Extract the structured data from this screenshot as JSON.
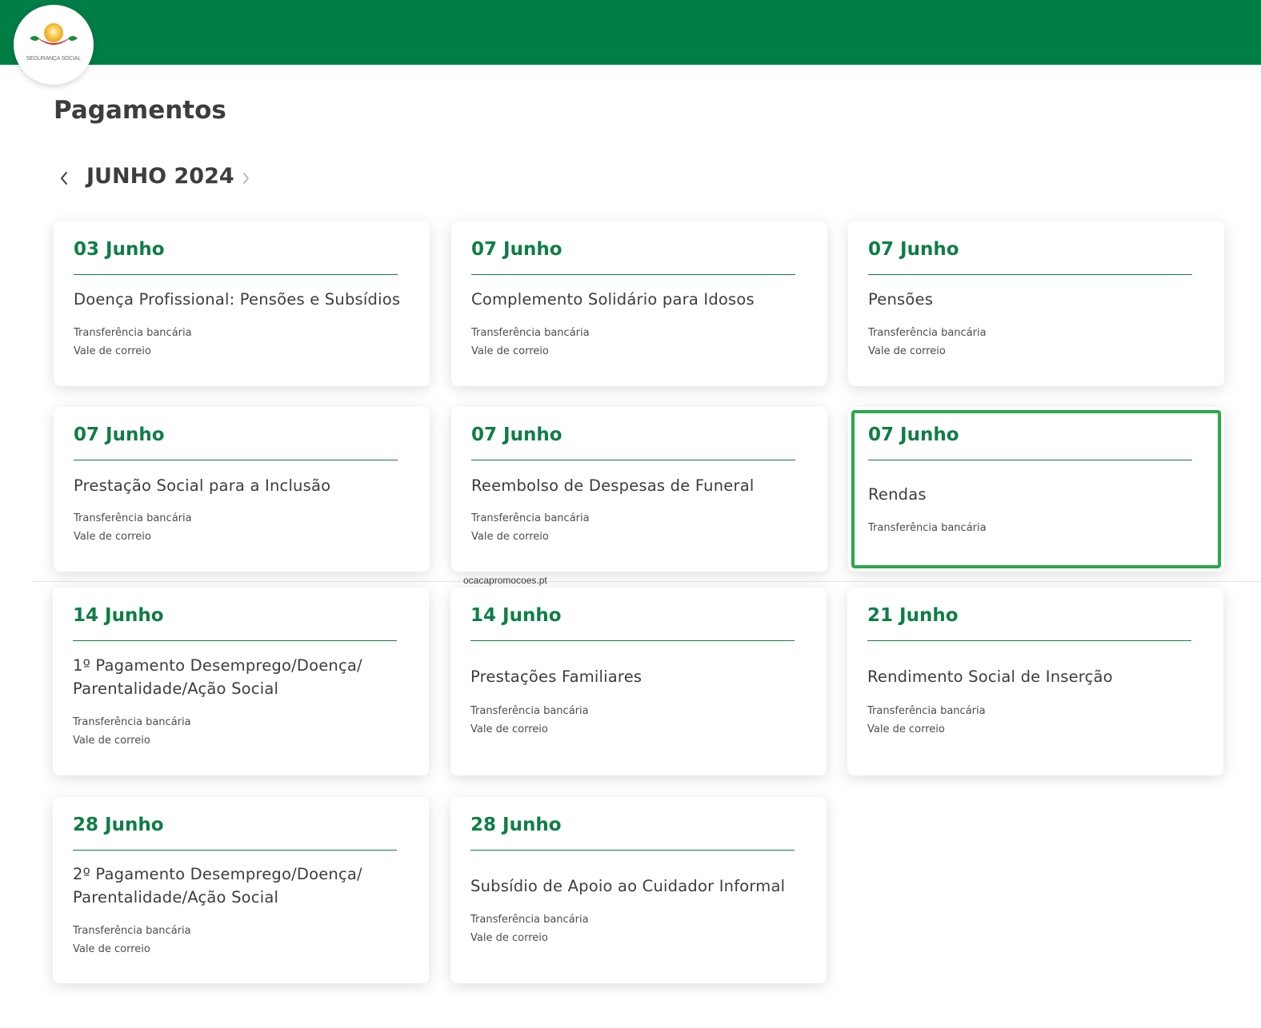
{
  "brand": {
    "name": "SEGURANÇA SOCIAL",
    "colors": {
      "header": "#017e45",
      "accent": "#0e7e46",
      "highlight": "#2aa84a"
    }
  },
  "page": {
    "title": "Pagamentos"
  },
  "month_nav": {
    "label": "JUNHO 2024",
    "prev_icon": "chevron-left-icon",
    "next_icon": "chevron-right-icon"
  },
  "cards": [
    {
      "date": "03 Junho",
      "title": "Doença Profissional: Pensões e Subsídios",
      "methods": [
        "Transferência bancária",
        "Vale de correio"
      ]
    },
    {
      "date": "07 Junho",
      "title": "Complemento Solidário para Idosos",
      "methods": [
        "Transferência bancária",
        "Vale de correio"
      ]
    },
    {
      "date": "07 Junho",
      "title": "Pensões",
      "methods": [
        "Transferência bancária",
        "Vale de correio"
      ]
    },
    {
      "date": "07 Junho",
      "title": "Prestação Social para a Inclusão",
      "methods": [
        "Transferência bancária",
        "Vale de correio"
      ]
    },
    {
      "date": "07 Junho",
      "title": "Reembolso de Despesas de Funeral",
      "methods": [
        "Transferência bancária",
        "Vale de correio"
      ]
    },
    {
      "date": "07 Junho",
      "title": "Rendas",
      "methods": [
        "Transferência bancária"
      ]
    },
    {
      "date": "14 Junho",
      "title": "1º Pagamento Desemprego/Doença/ Parentalidade/Ação Social",
      "methods": [
        "Transferência bancária",
        "Vale de correio"
      ]
    },
    {
      "date": "14 Junho",
      "title": "Prestações Familiares",
      "methods": [
        "Transferência bancária",
        "Vale de correio"
      ]
    },
    {
      "date": "21 Junho",
      "title": "Rendimento Social de Inserção",
      "methods": [
        "Transferência bancária",
        "Vale de correio"
      ]
    },
    {
      "date": "28 Junho",
      "title": "2º Pagamento Desemprego/Doença/ Parentalidade/Ação Social",
      "methods": [
        "Transferência bancária",
        "Vale de correio"
      ]
    },
    {
      "date": "28 Junho",
      "title": "Subsídio de Apoio ao Cuidador Informal",
      "methods": [
        "Transferência bancária",
        "Vale de correio"
      ]
    }
  ],
  "watermark": "ocacapromocoes.pt"
}
